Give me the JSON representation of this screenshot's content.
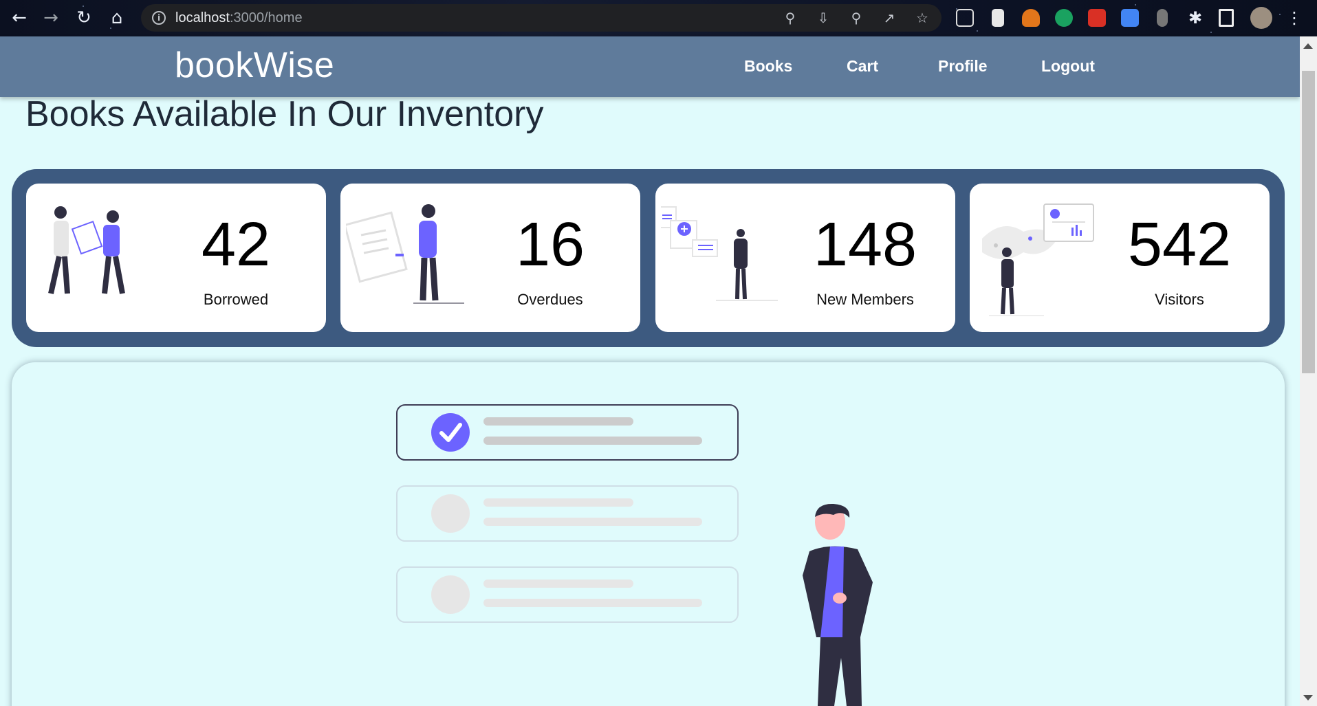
{
  "browser": {
    "url_host": "localhost",
    "url_path": ":3000/home"
  },
  "navbar": {
    "brand": "bookWise",
    "links": [
      "Books",
      "Cart",
      "Profile",
      "Logout"
    ]
  },
  "page": {
    "title": "Books Available In Our Inventory"
  },
  "stats": [
    {
      "value": "42",
      "label": "Borrowed",
      "icon": "people-exchanging-document-icon"
    },
    {
      "value": "16",
      "label": "Overdues",
      "icon": "person-with-document-icon"
    },
    {
      "value": "148",
      "label": "New Members",
      "icon": "person-adding-members-icon"
    },
    {
      "value": "542",
      "label": "Visitors",
      "icon": "person-viewing-world-map-icon"
    }
  ],
  "colors": {
    "background": "#e0fbfc",
    "navbar": "#5f7b9b",
    "stats_panel": "#3d5a80",
    "accent": "#6c63ff"
  }
}
